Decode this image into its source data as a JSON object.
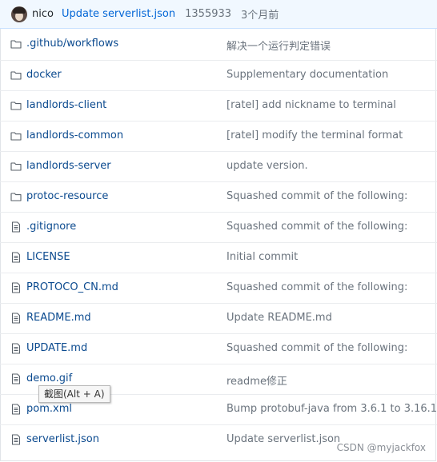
{
  "commit": {
    "author": "nico",
    "message": "Update serverlist.json",
    "sha": "1355933",
    "time_ago": "3个月前"
  },
  "files": [
    {
      "type": "folder",
      "icon": "folder-icon",
      "name": ".github/workflows",
      "message": "解决一个运行判定错误"
    },
    {
      "type": "folder",
      "icon": "folder-icon",
      "name": "docker",
      "message": "Supplementary documentation"
    },
    {
      "type": "folder",
      "icon": "folder-icon",
      "name": "landlords-client",
      "message": "[ratel] add nickname to terminal"
    },
    {
      "type": "folder",
      "icon": "folder-icon",
      "name": "landlords-common",
      "message": "[ratel] modify the terminal format"
    },
    {
      "type": "folder",
      "icon": "folder-icon",
      "name": "landlords-server",
      "message": "update version."
    },
    {
      "type": "folder",
      "icon": "folder-icon",
      "name": "protoc-resource",
      "message": "Squashed commit of the following:"
    },
    {
      "type": "file",
      "icon": "file-icon",
      "name": ".gitignore",
      "message": "Squashed commit of the following:"
    },
    {
      "type": "file",
      "icon": "file-icon",
      "name": "LICENSE",
      "message": "Initial commit"
    },
    {
      "type": "file",
      "icon": "file-icon",
      "name": "PROTOCO_CN.md",
      "message": "Squashed commit of the following:"
    },
    {
      "type": "file",
      "icon": "file-icon",
      "name": "README.md",
      "message": "Update README.md"
    },
    {
      "type": "file",
      "icon": "file-icon",
      "name": "UPDATE.md",
      "message": "Squashed commit of the following:"
    },
    {
      "type": "file",
      "icon": "file-icon",
      "name": "demo.gif",
      "message": "readme修正"
    },
    {
      "type": "file",
      "icon": "file-icon",
      "name": "pom.xml",
      "message": "Bump protobuf-java from 3.6.1 to 3.16.1"
    },
    {
      "type": "file",
      "icon": "file-icon",
      "name": "serverlist.json",
      "message": "Update serverlist.json"
    }
  ],
  "tooltip": "截图(Alt + A)",
  "watermark": "CSDN @myjackfox"
}
